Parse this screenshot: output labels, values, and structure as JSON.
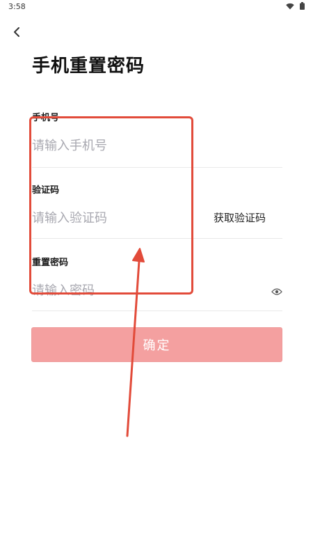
{
  "status_bar": {
    "time": "3:58",
    "icons": [
      "wifi-icon",
      "battery-icon"
    ]
  },
  "header": {
    "back_icon": "chevron-left-icon",
    "title": "手机重置密码"
  },
  "form": {
    "phone": {
      "label": "手机号",
      "placeholder": "请输入手机号",
      "value": ""
    },
    "code": {
      "label": "验证码",
      "placeholder": "请输入验证码",
      "value": "",
      "get_code_label": "获取验证码"
    },
    "password": {
      "label": "重置密码",
      "placeholder": "请输入密码",
      "value": "",
      "toggle_icon": "eye-icon"
    },
    "confirm_label": "确定"
  },
  "colors": {
    "confirm_button_bg": "#f4a0a0",
    "annotation": "#e24b3a",
    "placeholder": "#a8a8b0",
    "divider": "#e9e9e9"
  }
}
